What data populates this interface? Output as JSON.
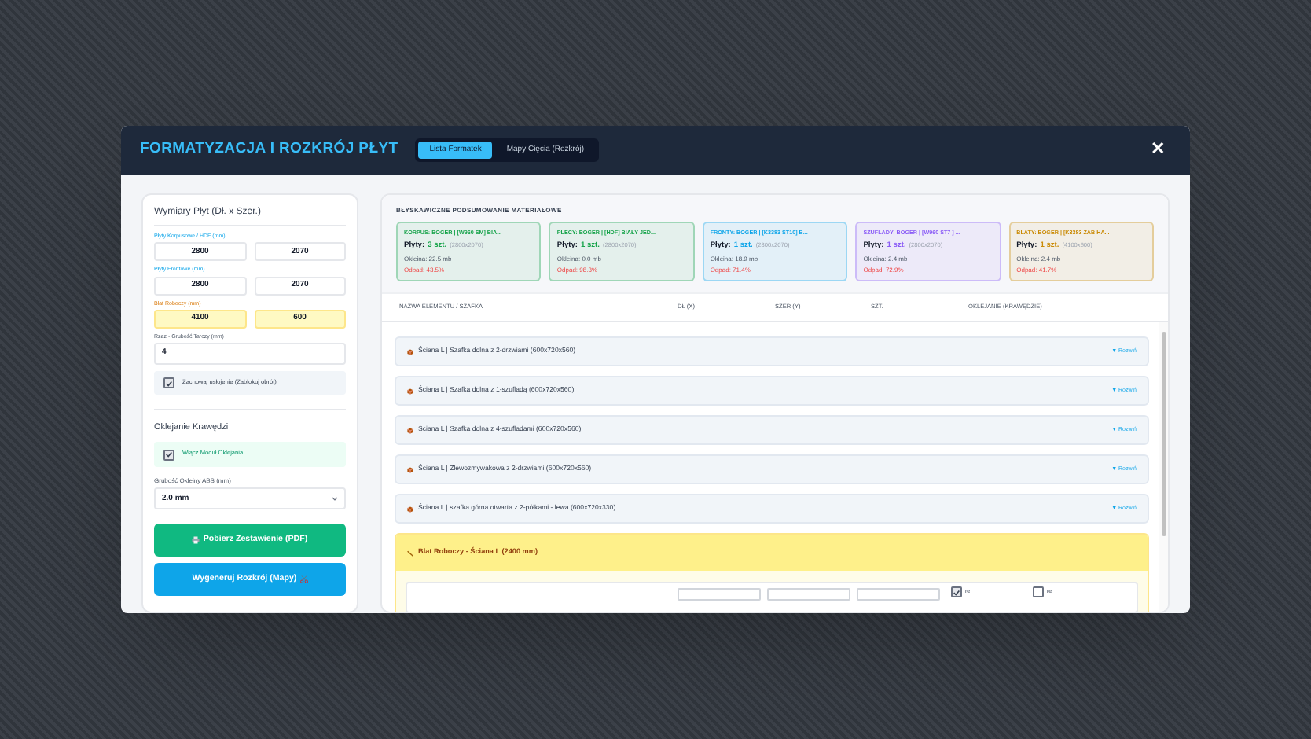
{
  "window": {
    "title": "FORMATYZACJA I ROZKRÓJ PŁYT",
    "close": "✕"
  },
  "tabs": [
    {
      "label": "Lista Formatek",
      "selected": true
    },
    {
      "label": "Mapy Cięcia (Rozkrój)",
      "selected": false
    }
  ],
  "sidebar": {
    "title": "Wymiary Płyt (Dł. x Szer.)",
    "dimension_groups": [
      {
        "label": "Płyty Korpusowe / HDF (mm)",
        "kind": "blue",
        "values": [
          "2800",
          "2070"
        ]
      },
      {
        "label": "Płyty Frontowe (mm)",
        "kind": "blue",
        "values": [
          "2800",
          "2070"
        ]
      },
      {
        "label": "Blat Roboczy (mm)",
        "kind": "amber",
        "values": [
          "4100",
          "600"
        ]
      }
    ],
    "kerf": {
      "label": "Rzaz - Grubość Tarczy (mm)",
      "value": "4"
    },
    "grain_option": {
      "label": "Zachowaj usłojenie (Zablokuj obrót)",
      "checked": true
    },
    "edging_title": "Oklejanie Krawędzi",
    "edging_option": {
      "label": "Włącz Moduł Oklejania",
      "checked": true
    },
    "abs_thickness": {
      "label": "Grubość Okleiny ABS (mm)",
      "value": "2.0 mm"
    },
    "buttons": [
      {
        "label": "Pobierz Zestawienie (PDF)",
        "kind": "pdf"
      },
      {
        "label": "Wygeneruj Rozkrój (Mapy)",
        "kind": "generate"
      }
    ]
  },
  "summary": {
    "title": "BŁYSKAWICZNE PODSUMOWANIE MATERIAŁOWE",
    "cards": [
      {
        "title": "KORPUS: BOGER | [W960 SM] BIA...",
        "sheets_label": "Płyty:",
        "sheets": "3 szt.",
        "size": "(2800x2070)",
        "edging": "Okleina: 22.5 mb",
        "waste": "Odpad: 43.5%",
        "color": "#16a34a"
      },
      {
        "title": "PLECY: BOGER | [HDF] BIAŁY JED...",
        "sheets_label": "Płyty:",
        "sheets": "1 szt.",
        "size": "(2800x2070)",
        "edging": "Okleina: 0.0 mb",
        "waste": "Odpad: 98.3%",
        "color": "#16a34a"
      },
      {
        "title": "FRONTY: BOGER | [K3383 ST10] B...",
        "sheets_label": "Płyty:",
        "sheets": "1 szt.",
        "size": "(2800x2070)",
        "edging": "Okleina: 18.9 mb",
        "waste": "Odpad: 71.4%",
        "color": "#0ea5e9"
      },
      {
        "title": "SZUFLADY: BOGER | [W960 ST7 ] ...",
        "sheets_label": "Płyty:",
        "sheets": "1 szt.",
        "size": "(2800x2070)",
        "edging": "Okleina: 2.4 mb",
        "waste": "Odpad: 72.9%",
        "color": "#8b5cf6"
      },
      {
        "title": "BLATY: BOGER | [K3383 ZAB HA...",
        "sheets_label": "Płyty:",
        "sheets": "1 szt.",
        "size": "(4100x600)",
        "edging": "Okleina: 2.4 mb",
        "waste": "Odpad: 41.7%",
        "color": "#ca8a04"
      }
    ]
  },
  "table": {
    "columns": [
      "NAZWA ELEMENTU / SZAFKA",
      "DŁ (X)",
      "SZER (Y)",
      "SZT.",
      "OKLEJANIE (KRAWĘDZIE)"
    ],
    "groups": [
      {
        "kind": "cabinet",
        "title": "Ściana L | Szafka dolna z 2-drzwiami (600x720x560)",
        "toggle": "▼ Rozwiń",
        "expanded": false
      },
      {
        "kind": "cabinet",
        "title": "Ściana L | Szafka dolna z 1-szufladą (600x720x560)",
        "toggle": "▼ Rozwiń",
        "expanded": false
      },
      {
        "kind": "cabinet",
        "title": "Ściana L | Szafka dolna z 4-szufladami (600x720x560)",
        "toggle": "▼ Rozwiń",
        "expanded": false
      },
      {
        "kind": "cabinet",
        "title": "Ściana L | Zlewozmywakowa z 2-drzwiami (600x720x560)",
        "toggle": "▼ Rozwiń",
        "expanded": false
      },
      {
        "kind": "cabinet",
        "title": "Ściana L | szafka górna otwarta z 2-półkami - lewa (600x720x330)",
        "toggle": "▼ Rozwiń",
        "expanded": false
      },
      {
        "kind": "worktop",
        "title": "Blat Roboczy - Ściana L (2400 mm)",
        "expanded": true,
        "edges": [
          {
            "label": "re",
            "checked": true
          },
          {
            "label": "re",
            "checked": false
          }
        ]
      }
    ]
  }
}
